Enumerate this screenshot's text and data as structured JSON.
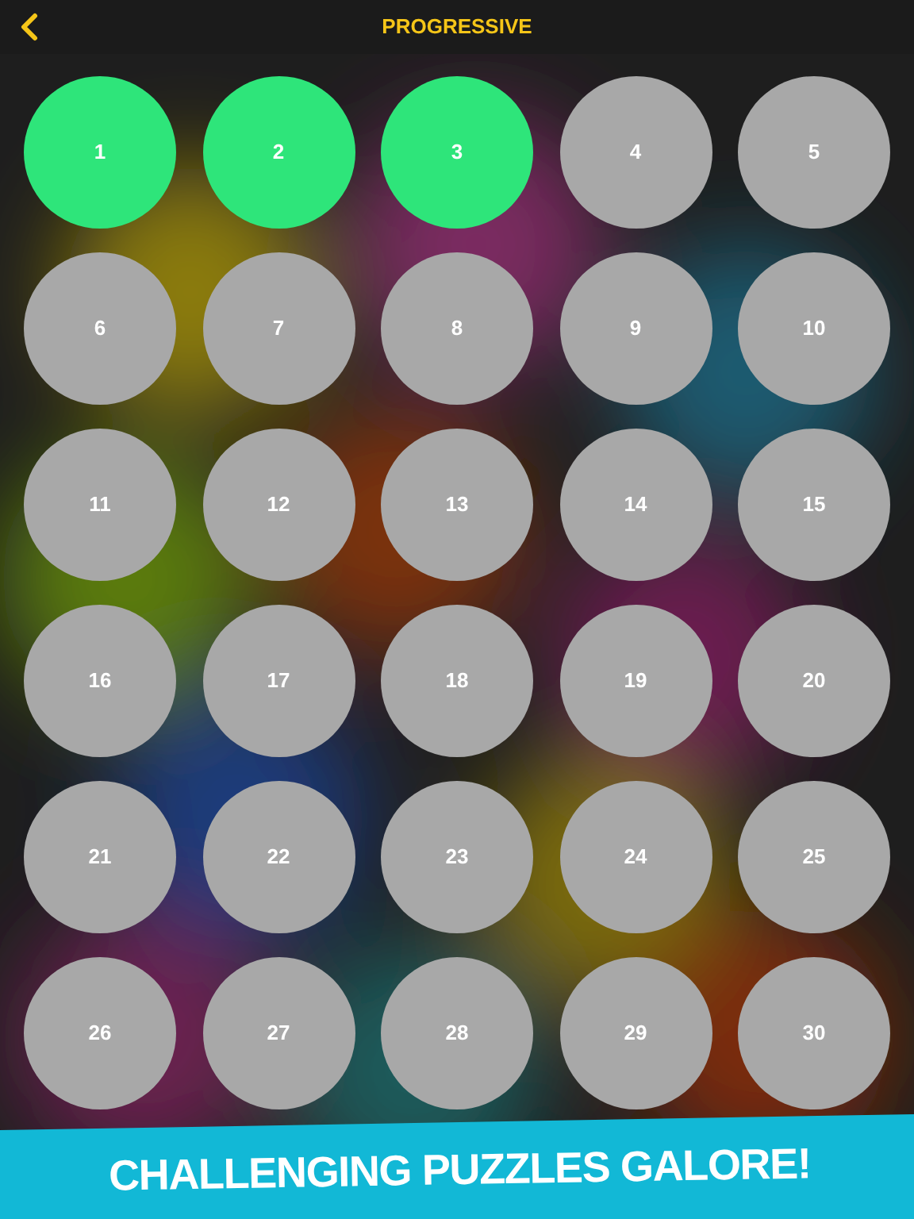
{
  "header": {
    "title": "PROGRESSIVE"
  },
  "levels": [
    {
      "label": "1",
      "completed": true
    },
    {
      "label": "2",
      "completed": true
    },
    {
      "label": "3",
      "completed": true
    },
    {
      "label": "4",
      "completed": false
    },
    {
      "label": "5",
      "completed": false
    },
    {
      "label": "6",
      "completed": false
    },
    {
      "label": "7",
      "completed": false
    },
    {
      "label": "8",
      "completed": false
    },
    {
      "label": "9",
      "completed": false
    },
    {
      "label": "10",
      "completed": false
    },
    {
      "label": "11",
      "completed": false
    },
    {
      "label": "12",
      "completed": false
    },
    {
      "label": "13",
      "completed": false
    },
    {
      "label": "14",
      "completed": false
    },
    {
      "label": "15",
      "completed": false
    },
    {
      "label": "16",
      "completed": false
    },
    {
      "label": "17",
      "completed": false
    },
    {
      "label": "18",
      "completed": false
    },
    {
      "label": "19",
      "completed": false
    },
    {
      "label": "20",
      "completed": false
    },
    {
      "label": "21",
      "completed": false
    },
    {
      "label": "22",
      "completed": false
    },
    {
      "label": "23",
      "completed": false
    },
    {
      "label": "24",
      "completed": false
    },
    {
      "label": "25",
      "completed": false
    },
    {
      "label": "26",
      "completed": false
    },
    {
      "label": "27",
      "completed": false
    },
    {
      "label": "28",
      "completed": false
    },
    {
      "label": "29",
      "completed": false
    },
    {
      "label": "30",
      "completed": false
    }
  ],
  "banner": {
    "text": "CHALLENGING PUZZLES GALORE!"
  }
}
